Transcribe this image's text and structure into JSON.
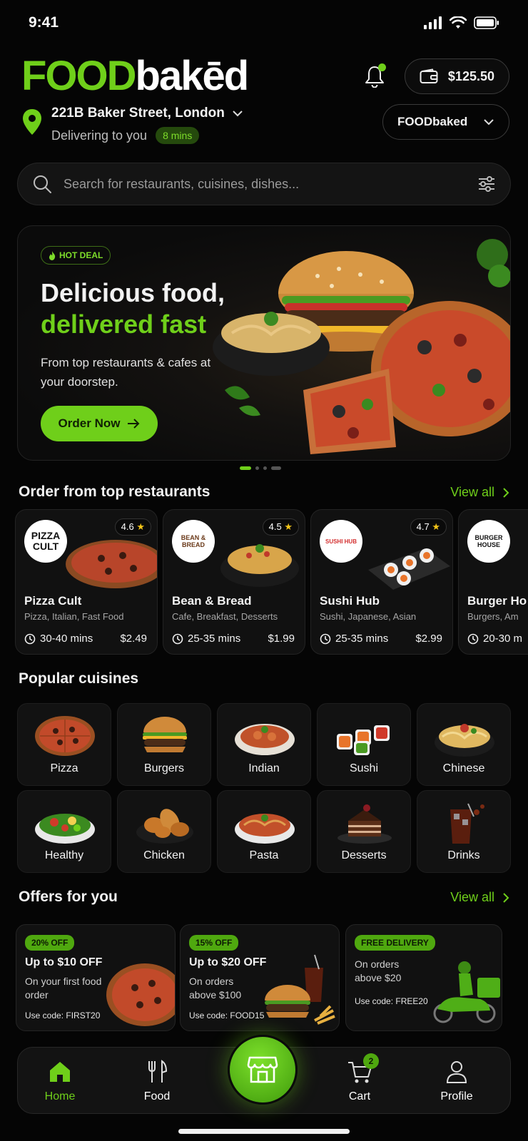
{
  "status": {
    "time": "9:41"
  },
  "header": {
    "logo_green": "FOOD",
    "logo_white": "bakēd",
    "wallet_balance": "$125.50",
    "brand_selector": "FOODbaked"
  },
  "location": {
    "address": "221B Baker Street, London",
    "delivering_text": "Delivering to you",
    "eta_badge": "8 mins"
  },
  "search": {
    "placeholder": "Search for restaurants, cuisines, dishes..."
  },
  "hero": {
    "badge": "HOT DEAL",
    "title_line1": "Delicious food,",
    "title_line2": "delivered fast",
    "subtitle": "From top restaurants & cafes at your doorstep.",
    "cta": "Order Now",
    "carousel_active": 1,
    "carousel_count": 4
  },
  "restaurants_section": {
    "title": "Order from top restaurants",
    "view_all": "View all",
    "items": [
      {
        "logo": "PIZZA CULT",
        "rating": "4.6",
        "name": "Pizza Cult",
        "tags": "Pizza, Italian, Fast Food",
        "time": "30-40 mins",
        "fee": "$2.49"
      },
      {
        "logo": "BEAN & BREAD",
        "rating": "4.5",
        "name": "Bean & Bread",
        "tags": "Cafe, Breakfast, Desserts",
        "time": "25-35 mins",
        "fee": "$1.99"
      },
      {
        "logo": "SUSHI HUB",
        "rating": "4.7",
        "name": "Sushi Hub",
        "tags": "Sushi, Japanese, Asian",
        "time": "25-35 mins",
        "fee": "$2.99"
      },
      {
        "logo": "BURGER HOUSE",
        "rating": "",
        "name": "Burger Ho",
        "tags": "Burgers, Am",
        "time": "20-30 m",
        "fee": ""
      }
    ]
  },
  "cuisines_section": {
    "title": "Popular cuisines",
    "items": [
      "Pizza",
      "Burgers",
      "Indian",
      "Sushi",
      "Chinese",
      "Healthy",
      "Chicken",
      "Pasta",
      "Desserts",
      "Drinks"
    ]
  },
  "offers_section": {
    "title": "Offers for you",
    "view_all": "View all",
    "items": [
      {
        "badge": "20% OFF",
        "title": "Up to $10 OFF",
        "desc": "On your first food order",
        "code": "Use code: FIRST20"
      },
      {
        "badge": "15% OFF",
        "title": "Up to $20 OFF",
        "desc": "On orders above $100",
        "code": "Use code: FOOD15"
      },
      {
        "badge": "FREE DELIVERY",
        "title": "",
        "desc": "On orders above $20",
        "code": "Use code: FREE20"
      }
    ]
  },
  "bottom_nav": {
    "home": "Home",
    "food": "Food",
    "cart": "Cart",
    "cart_count": "2",
    "profile": "Profile"
  },
  "colors": {
    "accent": "#6fcf1a",
    "background": "#050505",
    "card": "#111111"
  },
  "icons": [
    "signal-icon",
    "wifi-icon",
    "battery-icon",
    "bell-icon",
    "wallet-icon",
    "location-pin-icon",
    "chevron-down-icon",
    "search-icon",
    "filter-icon",
    "fire-icon",
    "arrow-right-icon",
    "star-icon",
    "clock-icon",
    "chevron-right-icon",
    "home-icon",
    "fork-knife-icon",
    "store-icon",
    "cart-icon",
    "profile-icon"
  ]
}
